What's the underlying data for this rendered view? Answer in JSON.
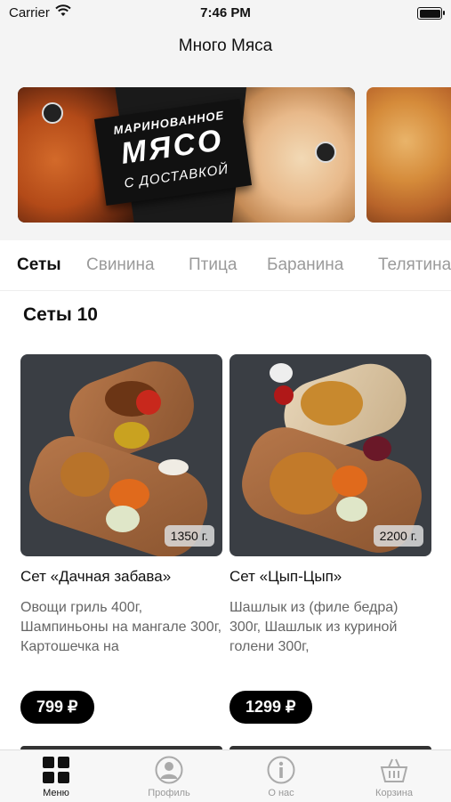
{
  "status_bar": {
    "carrier": "Carrier",
    "time": "7:46 PM"
  },
  "header": {
    "title": "Много Мяса"
  },
  "banner": {
    "line1": "МАРИНОВАННОЕ",
    "line2": "МЯСО",
    "line3": "С ДОСТАВКОЙ"
  },
  "categories": [
    "Сеты",
    "Свинина",
    "Птица",
    "Баранина",
    "Телятина"
  ],
  "section": {
    "title": "Сеты 10"
  },
  "products": [
    {
      "title": "Сет «Дачная забава»",
      "weight": "1350 г.",
      "description": "Овощи гриль 400г, Шампиньоны на мангале 300г, Картошечка на",
      "price": "799 ₽"
    },
    {
      "title": "Сет «Цып-Цып»",
      "weight": "2200 г.",
      "description": "Шашлык из (филе бедра) 300г, Шашлык из куриной голени 300г,",
      "price": "1299 ₽"
    }
  ],
  "tabbar": {
    "items": [
      {
        "label": "Меню",
        "icon": "grid-icon",
        "active": true
      },
      {
        "label": "Профиль",
        "icon": "profile-icon",
        "active": false
      },
      {
        "label": "О нас",
        "icon": "info-icon",
        "active": false
      },
      {
        "label": "Корзина",
        "icon": "basket-icon",
        "active": false
      }
    ]
  }
}
